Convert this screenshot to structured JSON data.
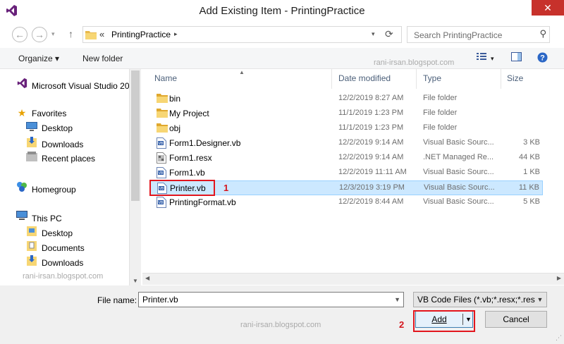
{
  "window": {
    "title": "Add Existing Item - PrintingPractice",
    "close_label": "✕"
  },
  "nav": {
    "back_icon": "←",
    "forward_icon": "→",
    "history_icon": "▾",
    "up_icon": "↑",
    "breadcrumb_sep": "«",
    "breadcrumb": "PrintingPractice",
    "crumb_arrow": "▸",
    "refresh_icon": "⟳",
    "search_placeholder": "Search PrintingPractice",
    "search_icon": "⚲"
  },
  "toolbar": {
    "organize_label": "Organize ▾",
    "new_folder_label": "New folder",
    "watermark": "rani-irsan.blogspot.com",
    "view_options_icon": "▾"
  },
  "sidebar": {
    "items": [
      {
        "label": "Microsoft Visual Studio 20",
        "icon": "visual-studio-icon",
        "indent": false
      },
      {
        "label": "Favorites",
        "icon": "star-icon",
        "indent": false
      },
      {
        "label": "Desktop",
        "icon": "desktop-icon",
        "indent": true
      },
      {
        "label": "Downloads",
        "icon": "downloads-icon",
        "indent": true
      },
      {
        "label": "Recent places",
        "icon": "recent-places-icon",
        "indent": true
      },
      {
        "label": "Homegroup",
        "icon": "homegroup-icon",
        "indent": false
      },
      {
        "label": "This PC",
        "icon": "computer-icon",
        "indent": false
      },
      {
        "label": "Desktop",
        "icon": "desktop-folder-icon",
        "indent": true
      },
      {
        "label": "Documents",
        "icon": "documents-icon",
        "indent": true
      },
      {
        "label": "Downloads",
        "icon": "downloads-icon",
        "indent": true
      }
    ],
    "watermark": "rani-irsan.blogspot.com"
  },
  "columns": {
    "name": "Name",
    "date": "Date modified",
    "type": "Type",
    "size": "Size"
  },
  "files": [
    {
      "name": "bin",
      "date": "12/2/2019 8:27 AM",
      "type": "File folder",
      "size": "",
      "icon": "folder-icon"
    },
    {
      "name": "My Project",
      "date": "11/1/2019 1:23 PM",
      "type": "File folder",
      "size": "",
      "icon": "folder-icon"
    },
    {
      "name": "obj",
      "date": "11/1/2019 1:23 PM",
      "type": "File folder",
      "size": "",
      "icon": "folder-icon"
    },
    {
      "name": "Form1.Designer.vb",
      "date": "12/2/2019 9:14 AM",
      "type": "Visual Basic Sourc...",
      "size": "3 KB",
      "icon": "vb-file-icon"
    },
    {
      "name": "Form1.resx",
      "date": "12/2/2019 9:14 AM",
      "type": ".NET Managed Re...",
      "size": "44 KB",
      "icon": "resx-file-icon"
    },
    {
      "name": "Form1.vb",
      "date": "12/2/2019 11:11 AM",
      "type": "Visual Basic Sourc...",
      "size": "1 KB",
      "icon": "vb-file-icon"
    },
    {
      "name": "Printer.vb",
      "date": "12/3/2019 3:19 PM",
      "type": "Visual Basic Sourc...",
      "size": "11 KB",
      "icon": "vb-file-icon",
      "selected": true
    },
    {
      "name": "PrintingFormat.vb",
      "date": "12/2/2019 8:44 AM",
      "type": "Visual Basic Sourc...",
      "size": "5 KB",
      "icon": "vb-file-icon"
    }
  ],
  "annotations": {
    "step1": "1",
    "step2": "2"
  },
  "footer": {
    "file_name_label": "File name:",
    "file_name_value": "Printer.vb",
    "file_type_value": "VB Code Files (*.vb;*.resx;*.resw",
    "add_label": "Add",
    "cancel_label": "Cancel",
    "watermark": "rani-irsan.blogspot.com"
  },
  "colors": {
    "selection_bg": "#cce8ff",
    "annotation_red": "#e2151d",
    "close_red": "#c7312b"
  }
}
